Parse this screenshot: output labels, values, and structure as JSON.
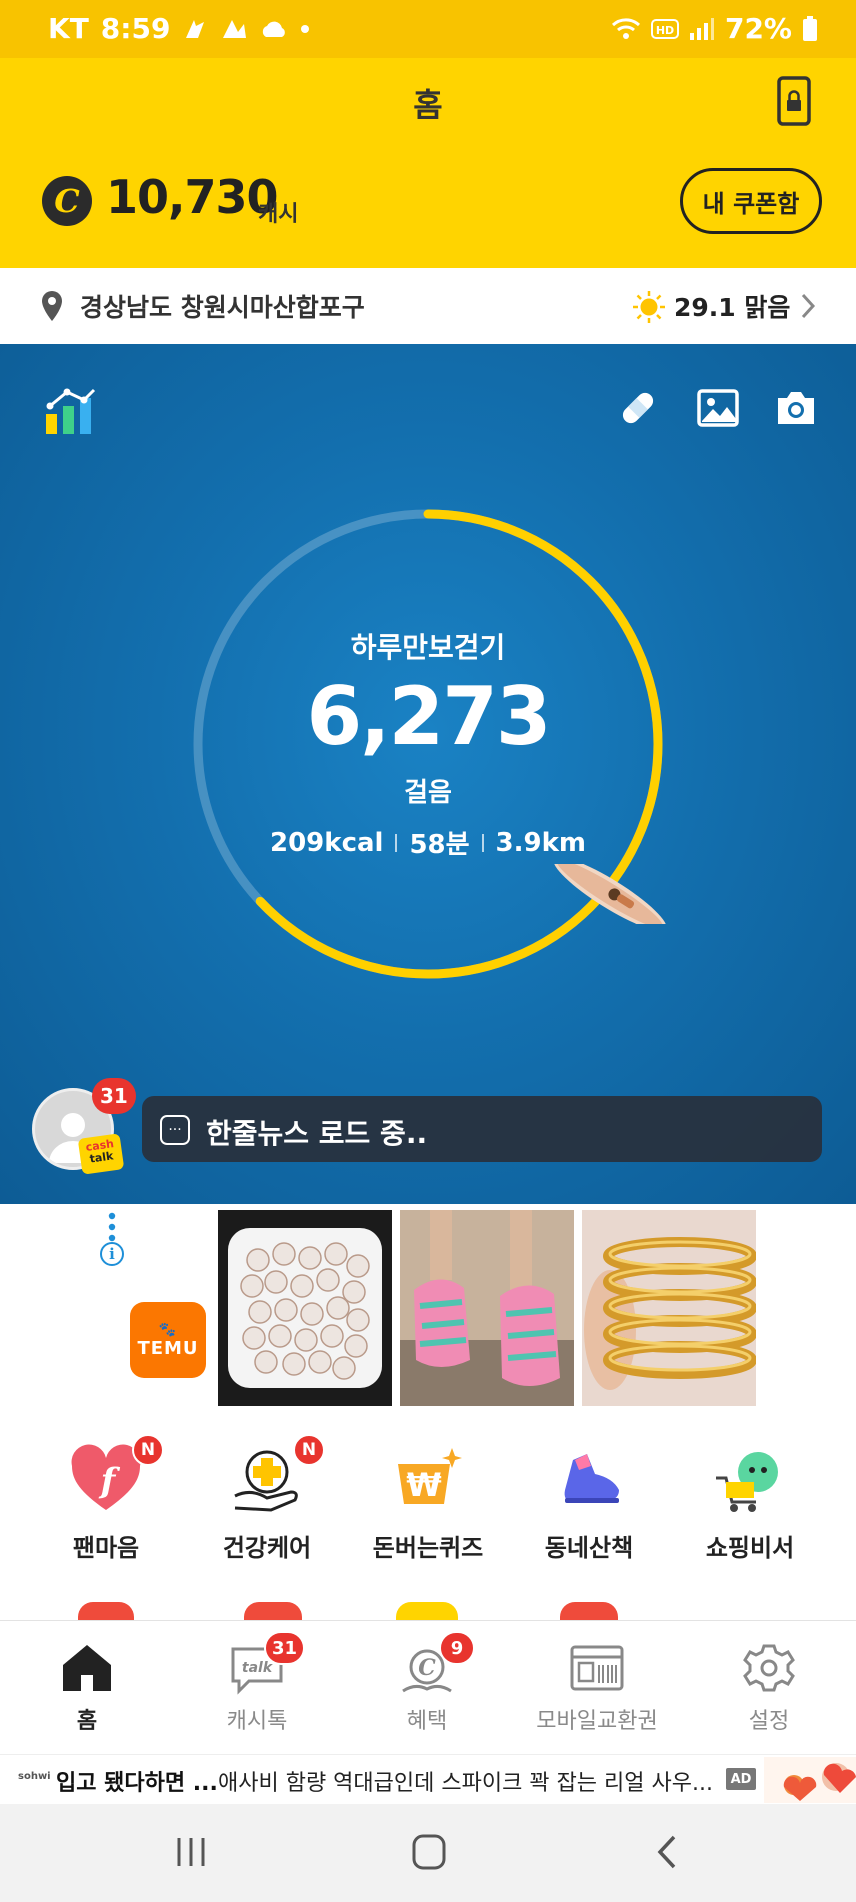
{
  "status_bar": {
    "carrier": "KT",
    "time": "8:59",
    "battery": "72%"
  },
  "header": {
    "title": "홈",
    "cash_symbol": "C",
    "cash_amount": "10,730",
    "cash_unit": "캐시",
    "coupon_button": "내 쿠폰함"
  },
  "location": {
    "address": "경상남도 창원시마산합포구",
    "weather": "29.1 맑음"
  },
  "steps": {
    "label": "하루만보걷기",
    "count": "6,273",
    "unit": "걸음",
    "kcal": "209kcal",
    "minutes": "58분",
    "distance": "3.9km",
    "progress": 0.63
  },
  "news": {
    "badge": "31",
    "chip_line1": "cash",
    "chip_line2": "talk",
    "text": "한줄뉴스 로드 중.."
  },
  "ad": {
    "brand_line1": "🐾",
    "brand_line2": "TEMU",
    "info": "i"
  },
  "menu": [
    {
      "label": "팬마음",
      "badge": "N"
    },
    {
      "label": "건강케어",
      "badge": "N"
    },
    {
      "label": "돈버는퀴즈",
      "badge": ""
    },
    {
      "label": "동네산책",
      "badge": ""
    },
    {
      "label": "쇼핑비서",
      "badge": ""
    }
  ],
  "bottom_nav": [
    {
      "label": "홈",
      "badge": ""
    },
    {
      "label": "캐시톡",
      "badge": "31"
    },
    {
      "label": "혜택",
      "badge": "9"
    },
    {
      "label": "모바일교환권",
      "badge": ""
    },
    {
      "label": "설정",
      "badge": ""
    }
  ],
  "banner": {
    "logo": "sohwi",
    "headline": "입고 됐다하면 ...",
    "text": "애사비 함량 역대급인데 스파이크 꽉 잡는 리얼 사우...",
    "ad_label": "AD"
  },
  "colors": {
    "brand_yellow": "#ffd400",
    "ring": "#ffd000",
    "badge_red": "#e8342e",
    "ocean": "#136fae"
  }
}
